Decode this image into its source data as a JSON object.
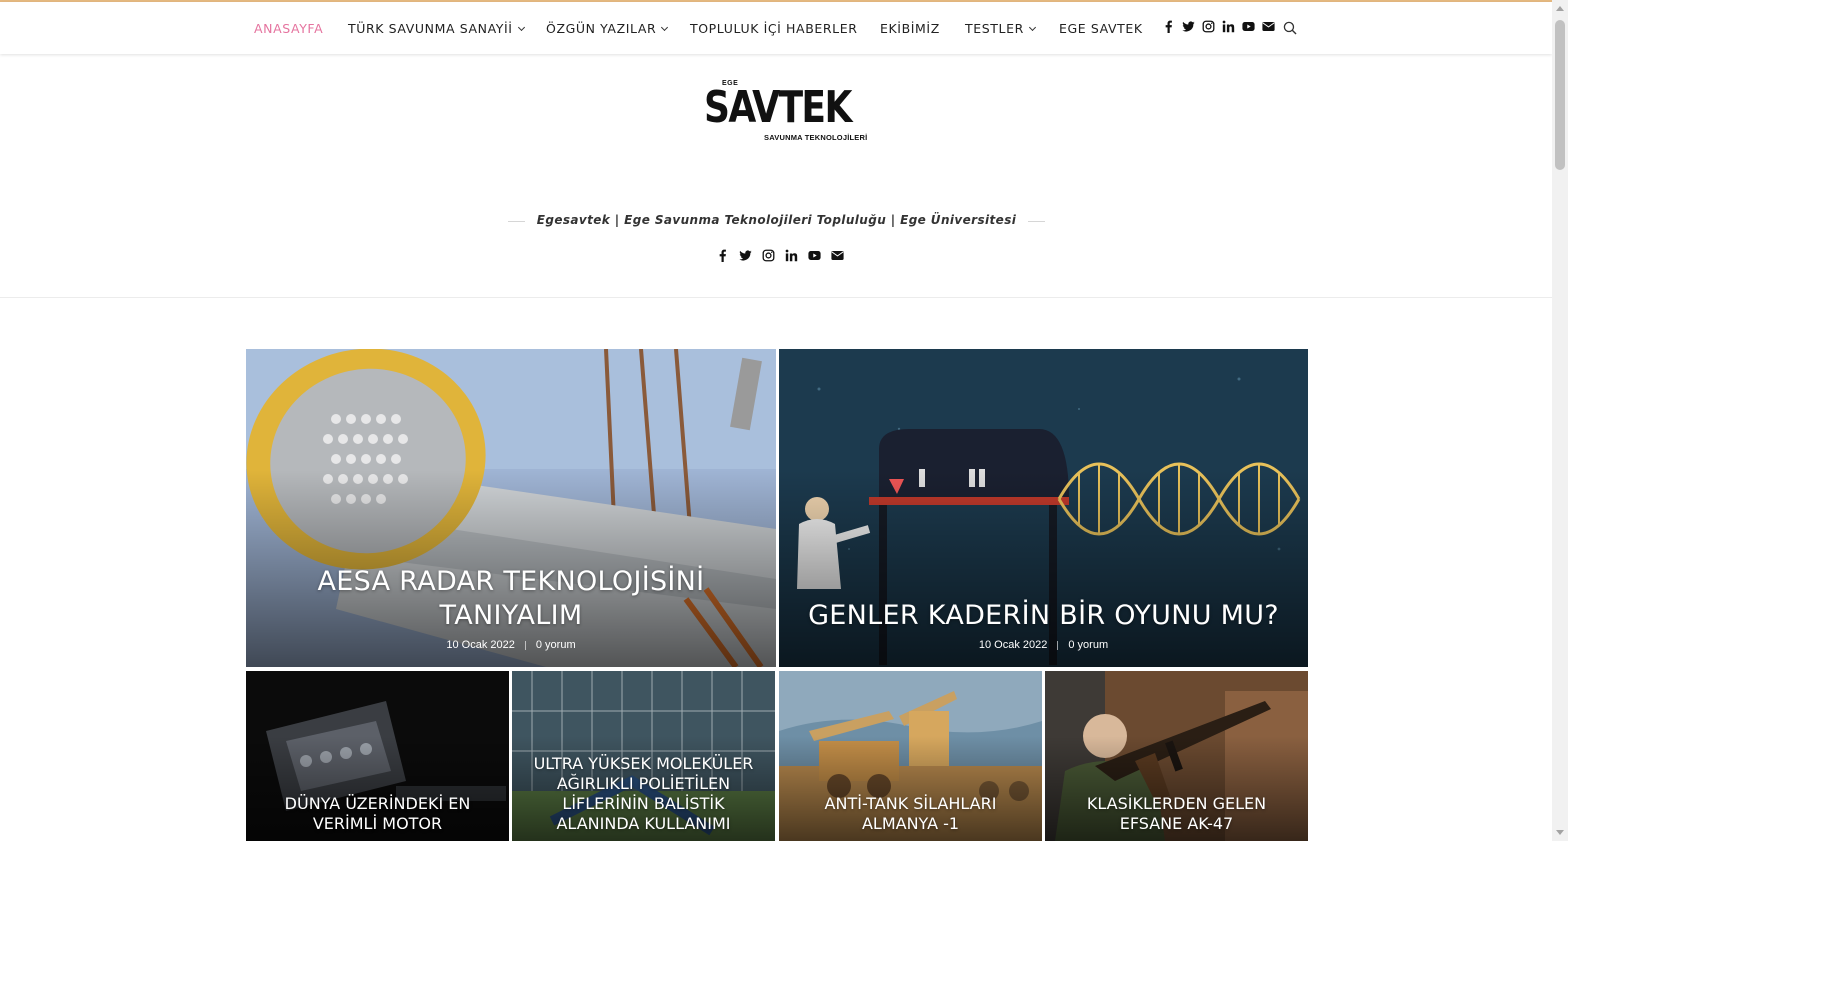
{
  "nav": {
    "items": [
      {
        "label": "ANASAYFA",
        "active": true,
        "dropdown": false
      },
      {
        "label": "TÜRK SAVUNMA SANAYİİ",
        "active": false,
        "dropdown": true
      },
      {
        "label": "ÖZGÜN YAZILAR",
        "active": false,
        "dropdown": true
      },
      {
        "label": "TOPLULUK İÇİ HABERLER",
        "active": false,
        "dropdown": false
      },
      {
        "label": "EKİBİMİZ",
        "active": false,
        "dropdown": false
      },
      {
        "label": "TESTLER",
        "active": false,
        "dropdown": true
      },
      {
        "label": "EGE SAVTEK",
        "active": false,
        "dropdown": false
      }
    ],
    "social_icons": [
      "facebook-icon",
      "twitter-icon",
      "instagram-icon",
      "linkedin-icon",
      "youtube-icon",
      "envelope-icon"
    ],
    "search_icon": "search-icon",
    "accent_color": "#e5749f"
  },
  "logo": {
    "small_top": "EGE",
    "main": "SAVTEK",
    "sub": "SAVUNMA TEKNOLOJİLERİ"
  },
  "tagline": "Egesavtek | Ege Savunma Teknolojileri Topluluğu | Ege Üniversitesi",
  "header_social_icons": [
    "facebook-icon",
    "twitter-icon",
    "instagram-icon",
    "linkedin-icon",
    "youtube-icon",
    "envelope-icon"
  ],
  "featured": [
    {
      "title": "AESA RADAR TEKNOLOJİSİNİ TANIYALIM",
      "date": "10 Ocak 2022",
      "comments": "0 yorum"
    },
    {
      "title": "GENLER KADERİN BİR OYUNU MU?",
      "date": "10 Ocak 2022",
      "comments": "0 yorum"
    }
  ],
  "grid": [
    {
      "title": "DÜNYA ÜZERİNDEKİ EN VERİMLİ MOTOR"
    },
    {
      "title": "ULTRA YÜKSEK MOLEKÜLER AĞIRLIKLI POLİETİLEN LİFLERİNİN BALİSTİK ALANINDA KULLANIMI"
    },
    {
      "title": "ANTİ-TANK SİLAHLARI ALMANYA -1"
    },
    {
      "title": "KLASİKLERDEN GELEN EFSANE AK-47"
    }
  ]
}
